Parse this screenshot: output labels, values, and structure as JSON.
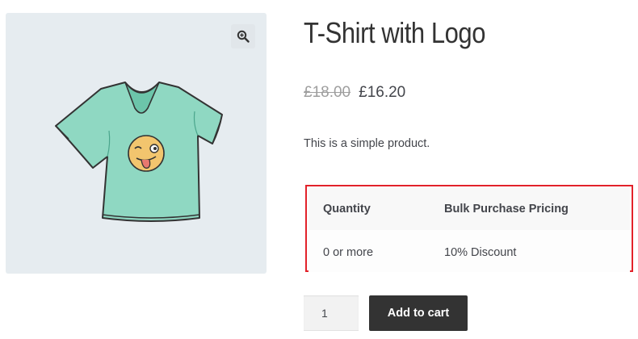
{
  "gallery": {
    "image_alt": "T-Shirt with Logo",
    "zoom_icon": "magnifier-plus-icon"
  },
  "product": {
    "title": "T-Shirt with Logo",
    "regular_price": "£18.00",
    "sale_price": "£16.20",
    "description": "This is a simple product."
  },
  "bulk_pricing": {
    "headers": [
      "Quantity",
      "Bulk Purchase Pricing"
    ],
    "rows": [
      [
        "0 or more",
        "10% Discount"
      ]
    ],
    "highlight_color": "#e2222a"
  },
  "cart": {
    "quantity_value": "1",
    "add_to_cart_label": "Add to cart",
    "button_color": "#333333"
  }
}
